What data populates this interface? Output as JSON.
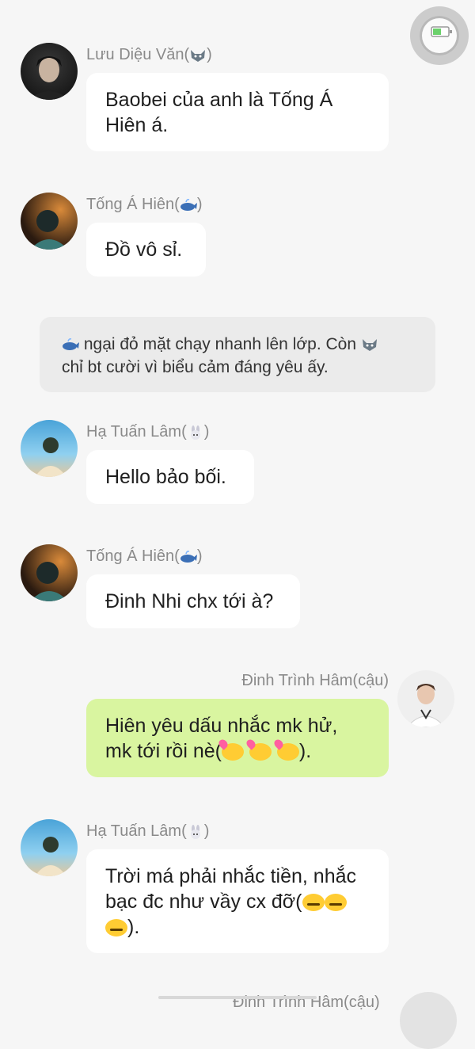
{
  "messages": [
    {
      "sender": "Lưu Diệu Văn",
      "tag_icon": "wolf-icon",
      "text_lines": [
        "Baobei của anh là Tống Á",
        "Hiên á."
      ]
    },
    {
      "sender": "Tống Á Hiên",
      "tag_icon": "whale-icon",
      "text": "Đồ vô sỉ."
    },
    {
      "sender": "Hạ Tuấn Lâm",
      "tag_icon": "rabbit-icon",
      "text": "Hello bảo bối."
    },
    {
      "sender": "Tống Á Hiên",
      "tag_icon": "whale-icon",
      "text": "Đinh Nhi chx tới à?"
    },
    {
      "sender": "Đinh Trình Hâm(cậu)",
      "mine": true,
      "line1": "Hiên yêu dấu nhắc mk hử,",
      "line2_prefix": "mk tới rồi nè(",
      "line2_suffix": ").",
      "emoji": "kissing-face-icon"
    },
    {
      "sender": "Hạ Tuấn Lâm",
      "tag_icon": "rabbit-icon",
      "line1": "Trời má phải nhắc tiền, nhắc",
      "line2": "bạc đc như vầy cx đỡ(",
      "line3_suffix": ").",
      "emoji": "expressionless-face-icon"
    }
  ],
  "narration": {
    "line1": "ngại đỏ mặt chạy nhanh lên lớp. Còn",
    "line2": "chỉ bt cười vì biểu cảm đáng yêu ấy."
  },
  "cutoff_sender": "Đinh Trình Hâm(cậu)",
  "colors": {
    "background": "#f6f6f6",
    "bubble": "#ffffff",
    "my_bubble": "#d9f5a0",
    "narration": "#ebebeb"
  }
}
